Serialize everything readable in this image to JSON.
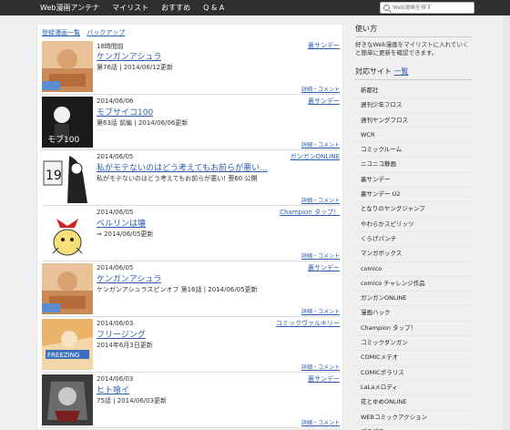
{
  "nav": {
    "brand": "Web漫画アンテナ",
    "items": [
      "マイリスト",
      "おすすめ",
      "Q & A"
    ],
    "search_placeholder": "Web漫画を探す"
  },
  "main": {
    "top_links": [
      "登録漫画一覧",
      "バックアップ"
    ],
    "detail_label": "詳細・コメント",
    "entries": [
      {
        "date": "18時間前",
        "title": "ケンガンアシュラ",
        "desc": "第76話 | 2014/06/12更新",
        "site": "裏サンデー"
      },
      {
        "date": "2014/06/06",
        "title": "モブサイコ100",
        "desc": "第63話 前編 | 2014/06/06更新",
        "site": "裏サンデー"
      },
      {
        "date": "2014/06/05",
        "title": "私がモテないのはどう考えてもお前らが悪い...",
        "desc": "私がモテないのはどう考えてもお前らが悪い! 喪60 公開",
        "site": "ガンガンONLINE"
      },
      {
        "date": "2014/06/05",
        "title": "ベルリンは壊",
        "desc": "⇒ 2014/06/05更新",
        "site": "Champion タップ！"
      },
      {
        "date": "2014/06/05",
        "title": "ケンガンアシュラ",
        "desc": "ケンガンアシュラスピンオフ 第16話 | 2014/06/05更新",
        "site": "裏サンデー"
      },
      {
        "date": "2014/06/03",
        "title": "フリージング",
        "desc": "2014年6月3日更新",
        "site": "コミックヴァルキリー"
      },
      {
        "date": "2014/06/03",
        "title": "ヒト喰イ",
        "desc": "75話 | 2014/06/03更新",
        "site": "裏サンデー"
      }
    ]
  },
  "sidebar": {
    "usage_title": "使い方",
    "usage_text": "好きなWeb漫画をマイリストに入れていくと簡単に更新を確認できます。",
    "sites_title": "対応サイト",
    "sites_link": "一覧",
    "sites": [
      "新都社",
      "週刊少年フロス",
      "週刊ヤングフロス",
      "WCR",
      "コミックルーム",
      "ニコニコ静画",
      "裏サンデー",
      "裏サンデー U2",
      "となりのヤングジャンプ",
      "やわらかスピリッツ",
      "くらげパンチ",
      "マンガボックス",
      "comico",
      "comico チャレンジ作品",
      "ガンガンONLINE",
      "漫画ハック",
      "Champion タップ！",
      "コミックダンガン",
      "COMICメテオ",
      "COMICポラリス",
      "LaLaメロディ",
      "花とゆめONLINE",
      "WEBコミックアクション",
      "ぽこぽこ"
    ]
  },
  "colors": {
    "topbar": "#2f2f2f",
    "link": "#2a5db0"
  }
}
